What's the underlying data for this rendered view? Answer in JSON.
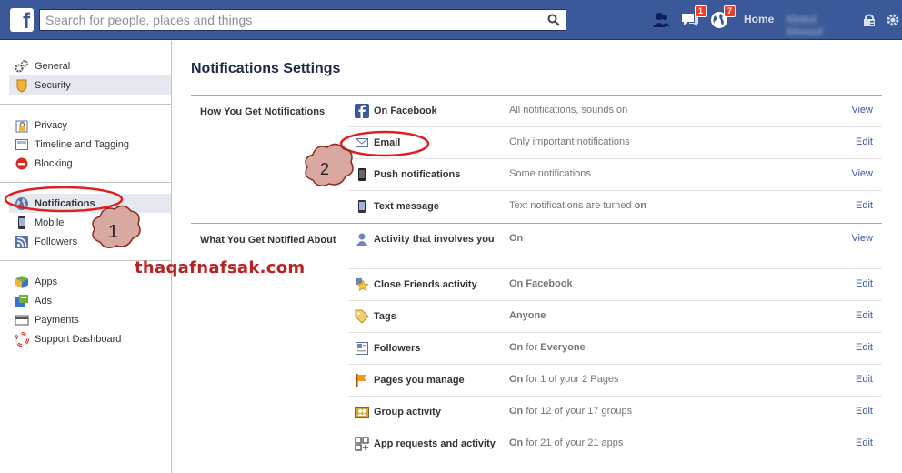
{
  "topbar": {
    "search_placeholder": "Search for people, places and things",
    "home_label": "Home",
    "messages_count": "1",
    "notifications_count": "7",
    "user_name": "Abdul Ahmed"
  },
  "sidebar": {
    "groups": [
      [
        {
          "label": "General",
          "icon": "gears-icon"
        },
        {
          "label": "Security",
          "icon": "shield-icon"
        }
      ],
      [
        {
          "label": "Privacy",
          "icon": "lock-icon"
        },
        {
          "label": "Timeline and Tagging",
          "icon": "timeline-icon"
        },
        {
          "label": "Blocking",
          "icon": "blocking-icon"
        }
      ],
      [
        {
          "label": "Notifications",
          "icon": "globe-icon"
        },
        {
          "label": "Mobile",
          "icon": "mobile-icon"
        },
        {
          "label": "Followers",
          "icon": "rss-icon"
        }
      ],
      [
        {
          "label": "Apps",
          "icon": "cube-icon"
        },
        {
          "label": "Ads",
          "icon": "ads-icon"
        },
        {
          "label": "Payments",
          "icon": "card-icon"
        },
        {
          "label": "Support Dashboard",
          "icon": "lifebuoy-icon"
        }
      ]
    ]
  },
  "main": {
    "title": "Notifications Settings",
    "how": {
      "label": "How You Get Notifications",
      "rows": [
        {
          "name": "On Facebook",
          "status": "All notifications, sounds on",
          "action": "View"
        },
        {
          "name": "Email",
          "status": "Only important notifications",
          "action": "Edit"
        },
        {
          "name": "Push notifications",
          "status": "Some notifications",
          "action": "View"
        },
        {
          "name": "Text message",
          "status_pre": "Text notifications are turned ",
          "status_bold": "on",
          "action": "Edit"
        }
      ]
    },
    "what": {
      "label": "What You Get Notified About",
      "rows": [
        {
          "name": "Activity that involves you",
          "status_bold": "On",
          "status_rest": "",
          "action": "View"
        },
        {
          "name": "Close Friends activity",
          "status_bold": "On Facebook",
          "status_rest": "",
          "action": "Edit"
        },
        {
          "name": "Tags",
          "status_bold": "Anyone",
          "status_rest": "",
          "action": "Edit"
        },
        {
          "name": "Followers",
          "status_bold": "On",
          "status_rest": " for ",
          "status_bold2": "Everyone",
          "action": "Edit"
        },
        {
          "name": "Pages you manage",
          "status_bold": "On",
          "status_rest": " for 1 of your 2 Pages",
          "action": "Edit"
        },
        {
          "name": "Group activity",
          "status_bold": "On",
          "status_rest": " for 12 of your 17 groups",
          "action": "Edit"
        },
        {
          "name": "App requests and activity",
          "status_bold": "On",
          "status_rest": " for 21 of your 21 apps",
          "action": "Edit"
        }
      ]
    }
  },
  "annotations": {
    "callout_1": "1",
    "callout_2": "2",
    "watermark": "thaqafnafsak.com"
  }
}
